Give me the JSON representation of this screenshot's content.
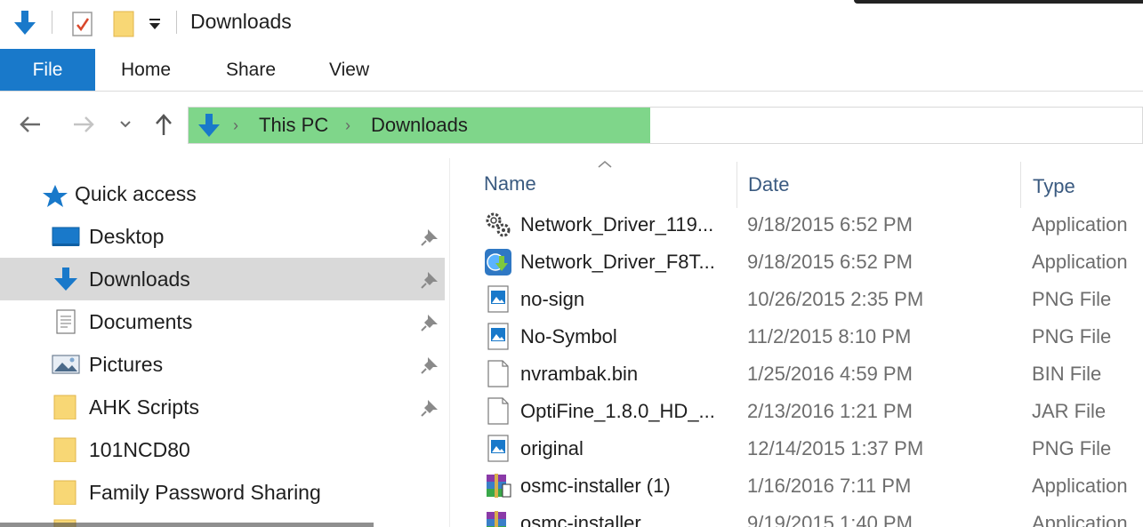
{
  "title": "Downloads",
  "ribbon": {
    "file": "File",
    "home": "Home",
    "share": "Share",
    "view": "View"
  },
  "address": {
    "this_pc": "This PC",
    "downloads": "Downloads"
  },
  "nav": {
    "quick_access": "Quick access",
    "items": [
      {
        "label": "Desktop",
        "pinned": true
      },
      {
        "label": "Downloads",
        "pinned": true,
        "selected": true
      },
      {
        "label": "Documents",
        "pinned": true
      },
      {
        "label": "Pictures",
        "pinned": true
      },
      {
        "label": "AHK Scripts",
        "pinned": true
      },
      {
        "label": "101NCD80",
        "pinned": false
      },
      {
        "label": "Family Password Sharing",
        "pinned": false
      }
    ]
  },
  "columns": {
    "name": "Name",
    "date": "Date",
    "type": "Type"
  },
  "files": [
    {
      "name": "Network_Driver_119...",
      "date": "9/18/2015 6:52 PM",
      "type": "Application",
      "icon": "setup-gear-icon"
    },
    {
      "name": "Network_Driver_F8T...",
      "date": "9/18/2015 6:52 PM",
      "type": "Application",
      "icon": "installer-globe-icon"
    },
    {
      "name": "no-sign",
      "date": "10/26/2015 2:35 PM",
      "type": "PNG File",
      "icon": "image-file-icon"
    },
    {
      "name": "No-Symbol",
      "date": "11/2/2015 8:10 PM",
      "type": "PNG File",
      "icon": "image-file-icon"
    },
    {
      "name": "nvrambak.bin",
      "date": "1/25/2016 4:59 PM",
      "type": "BIN File",
      "icon": "blank-file-icon"
    },
    {
      "name": "OptiFine_1.8.0_HD_...",
      "date": "2/13/2016 1:21 PM",
      "type": "JAR File",
      "icon": "blank-file-icon"
    },
    {
      "name": "original",
      "date": "12/14/2015 1:37 PM",
      "type": "PNG File",
      "icon": "image-file-icon"
    },
    {
      "name": "osmc-installer (1)",
      "date": "1/16/2016 7:11 PM",
      "type": "Application",
      "icon": "archive-installer-icon"
    },
    {
      "name": "osmc-installer",
      "date": "9/19/2015 1:40 PM",
      "type": "Application",
      "icon": "archive-installer-icon"
    }
  ],
  "colors": {
    "accent": "#1979ca",
    "address_highlight": "#7fd68a",
    "selection": "#d9d9d9",
    "folder": "#f8d775",
    "header_text": "#3a5a80"
  }
}
